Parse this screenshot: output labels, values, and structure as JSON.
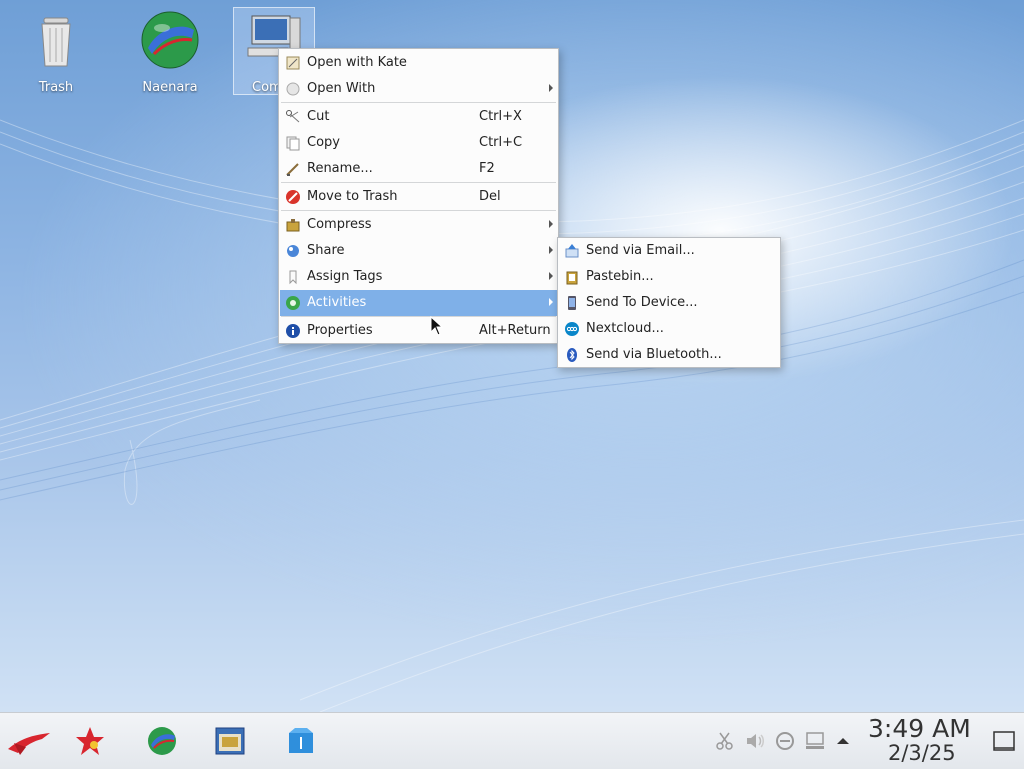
{
  "desktop": {
    "icons": [
      {
        "label": "Trash"
      },
      {
        "label": "Naenara"
      },
      {
        "label": "Com"
      }
    ]
  },
  "context_menu": {
    "items": [
      {
        "label": "Open with Kate",
        "shortcut": "",
        "icon": "kate-icon"
      },
      {
        "label": "Open With",
        "shortcut": "",
        "icon": "open-with-icon",
        "submenu": true
      },
      {
        "label": "Cut",
        "shortcut": "Ctrl+X",
        "icon": "scissors-icon"
      },
      {
        "label": "Copy",
        "shortcut": "Ctrl+C",
        "icon": "copy-icon"
      },
      {
        "label": "Rename...",
        "shortcut": "F2",
        "icon": "rename-icon"
      },
      {
        "label": "Move to Trash",
        "shortcut": "Del",
        "icon": "trash-icon"
      },
      {
        "label": "Compress",
        "shortcut": "",
        "icon": "compress-icon",
        "submenu": true
      },
      {
        "label": "Share",
        "shortcut": "",
        "icon": "share-icon",
        "submenu": true
      },
      {
        "label": "Assign Tags",
        "shortcut": "",
        "icon": "tag-icon",
        "submenu": true
      },
      {
        "label": "Activities",
        "shortcut": "",
        "icon": "activities-icon",
        "submenu": true,
        "highlighted": true
      },
      {
        "label": "Properties",
        "shortcut": "Alt+Return",
        "icon": "info-icon"
      }
    ]
  },
  "share_submenu": {
    "items": [
      {
        "label": "Send via Email...",
        "icon": "email-icon"
      },
      {
        "label": "Pastebin...",
        "icon": "pastebin-icon"
      },
      {
        "label": "Send To Device...",
        "icon": "device-icon"
      },
      {
        "label": "Nextcloud...",
        "icon": "nextcloud-icon"
      },
      {
        "label": "Send via Bluetooth...",
        "icon": "bluetooth-icon"
      }
    ]
  },
  "taskbar": {
    "clock_time": "3:49 AM",
    "clock_date": "2/3/25"
  },
  "colors": {
    "highlight": "#7fb0e8",
    "menu_bg": "#fcfcfc"
  }
}
